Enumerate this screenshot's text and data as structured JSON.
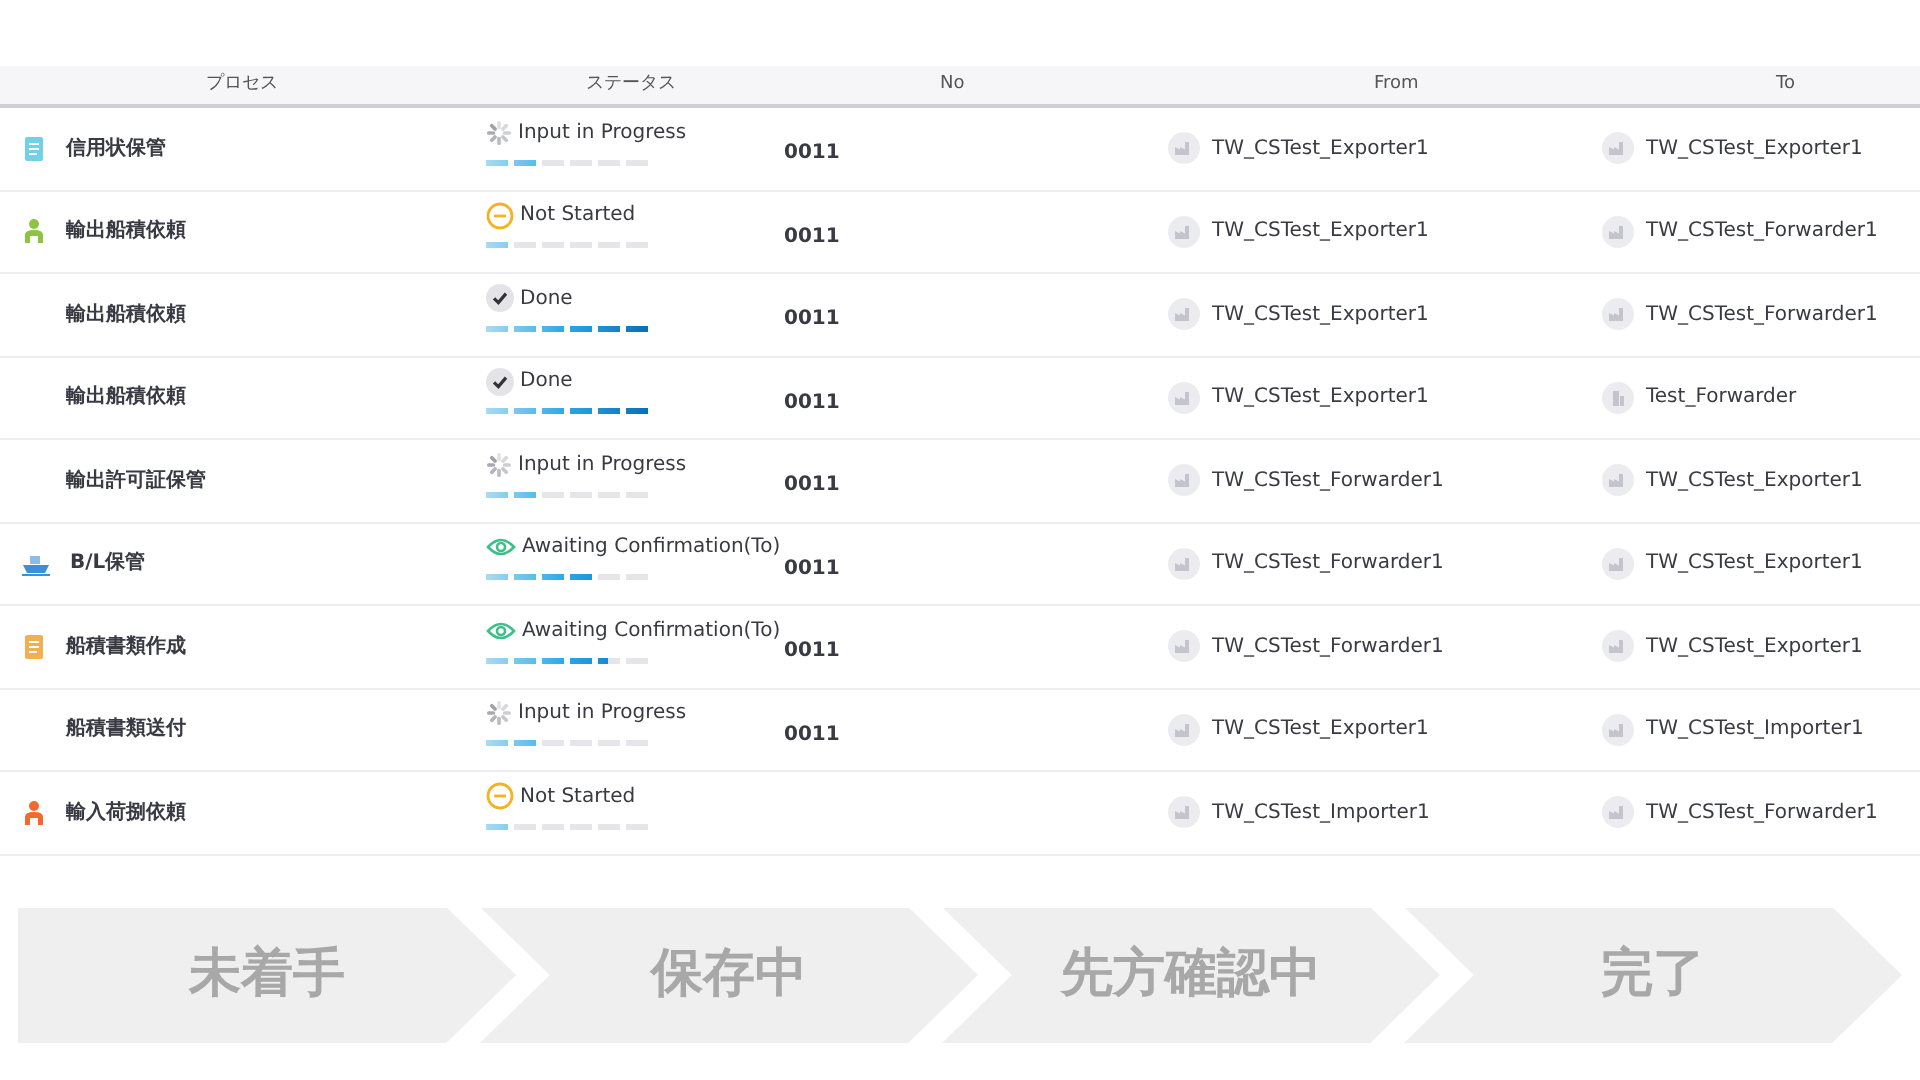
{
  "table": {
    "columns": [
      "プロセス",
      "ステータス",
      "No",
      "From",
      "To"
    ],
    "rows": [
      {
        "process": {
          "text": "信用状保管",
          "kind": "ledger"
        },
        "status": {
          "text": "Input in Progress",
          "kind": "progress",
          "level": 0.333
        },
        "no": "0011",
        "from": {
          "text": "TW_CSTest_Exporter1",
          "kind": "factory"
        },
        "to": {
          "text": "TW_CSTest_Exporter1",
          "kind": "factory"
        }
      },
      {
        "process": {
          "text": "輸出船積依頼",
          "kind": "shipper"
        },
        "status": {
          "text": "Not Started",
          "kind": "not_started",
          "level": 0.167
        },
        "no": "0011",
        "from": {
          "text": "TW_CSTest_Exporter1",
          "kind": "factory"
        },
        "to": {
          "text": "TW_CSTest_Forwarder1",
          "kind": "factory"
        }
      },
      {
        "process": {
          "text": "輸出船積依頼"
        },
        "status": {
          "text": "Done",
          "kind": "done",
          "level": 1
        },
        "no": "0011",
        "from": {
          "text": "TW_CSTest_Exporter1",
          "kind": "factory"
        },
        "to": {
          "text": "TW_CSTest_Forwarder1",
          "kind": "factory"
        }
      },
      {
        "process": {
          "text": "輸出船積依頼"
        },
        "status": {
          "text": "Done",
          "kind": "done",
          "level": 1
        },
        "no": "0011",
        "from": {
          "text": "TW_CSTest_Exporter1",
          "kind": "factory"
        },
        "to": {
          "text": "Test_Forwarder",
          "kind": "building"
        }
      },
      {
        "process": {
          "text": "輸出許可証保管"
        },
        "status": {
          "text": "Input in Progress",
          "kind": "progress",
          "level": 0.333
        },
        "no": "0011",
        "from": {
          "text": "TW_CSTest_Forwarder1",
          "kind": "factory"
        },
        "to": {
          "text": "TW_CSTest_Exporter1",
          "kind": "factory"
        }
      },
      {
        "process": {
          "text": "B/L保管",
          "kind": "ship"
        },
        "status": {
          "text": "Awaiting Confirmation(To)",
          "kind": "awaiting",
          "level": 0.667
        },
        "no": "0011",
        "from": {
          "text": "TW_CSTest_Forwarder1",
          "kind": "factory"
        },
        "to": {
          "text": "TW_CSTest_Exporter1",
          "kind": "factory"
        }
      },
      {
        "process": {
          "text": "船積書類作成",
          "kind": "form"
        },
        "status": {
          "text": "Awaiting Confirmation(To)",
          "kind": "awaiting",
          "level": 0.75
        },
        "no": "0011",
        "from": {
          "text": "TW_CSTest_Forwarder1",
          "kind": "factory"
        },
        "to": {
          "text": "TW_CSTest_Exporter1",
          "kind": "factory"
        }
      },
      {
        "process": {
          "text": "船積書類送付"
        },
        "status": {
          "text": "Input in Progress",
          "kind": "progress",
          "level": 0.333
        },
        "no": "0011",
        "from": {
          "text": "TW_CSTest_Exporter1",
          "kind": "factory"
        },
        "to": {
          "text": "TW_CSTest_Importer1",
          "kind": "factory"
        }
      },
      {
        "process": {
          "text": "輸入荷捌依頼",
          "kind": "receiver"
        },
        "status": {
          "text": "Not Started",
          "kind": "not_started",
          "level": 0.167
        },
        "from": {
          "text": "TW_CSTest_Importer1",
          "kind": "factory"
        },
        "to": {
          "text": "TW_CSTest_Forwarder1",
          "kind": "factory"
        }
      }
    ]
  },
  "stages": [
    "未着手",
    "保存中",
    "先方確認中",
    "完了"
  ]
}
